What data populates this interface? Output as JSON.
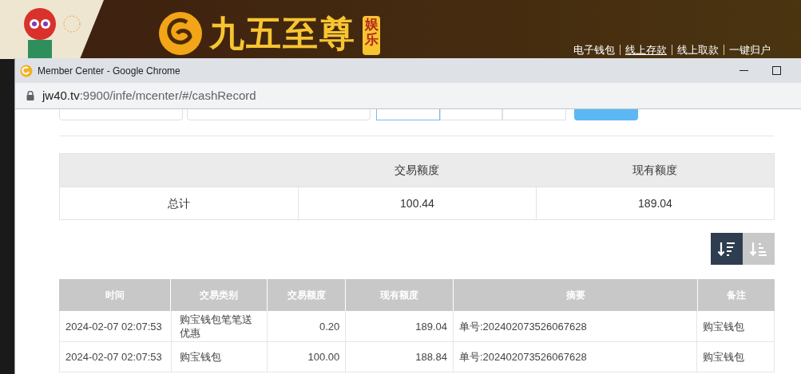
{
  "site": {
    "logo_text": "九五至尊",
    "logo_badge": "娱乐",
    "nav": [
      {
        "label": "电子钱包",
        "selected": false
      },
      {
        "label": "线上存款",
        "selected": true
      },
      {
        "label": "线上取款",
        "selected": false
      },
      {
        "label": "一键归户",
        "selected": false
      }
    ]
  },
  "window": {
    "title": "Member Center - Google Chrome",
    "url_host": "jw40.tv",
    "url_rest": ":9900/infe/mcenter/#/cashRecord"
  },
  "filters": [
    {
      "kind": "input"
    },
    {
      "kind": "input"
    },
    {
      "kind": "segment",
      "selected": true
    },
    {
      "kind": "segment",
      "selected": false
    },
    {
      "kind": "segment",
      "selected": false
    },
    {
      "kind": "button"
    }
  ],
  "summary": {
    "columns": [
      "",
      "交易额度",
      "现有额度"
    ],
    "row": [
      "总计",
      "100.44",
      "189.04"
    ]
  },
  "sort_buttons": [
    {
      "kind": "descending",
      "selected": true
    },
    {
      "kind": "ascending",
      "selected": false
    }
  ],
  "table": {
    "columns": [
      "时间",
      "交易类别",
      "交易额度",
      "现有额度",
      "摘要",
      "备注"
    ],
    "rows": [
      [
        "2024-02-07 02:07:53",
        "购宝钱包笔笔送优惠",
        "0.20",
        "189.04",
        "单号:202402073526067628",
        "购宝钱包"
      ],
      [
        "2024-02-07 02:07:53",
        "购宝钱包",
        "100.00",
        "188.84",
        "单号:202402073526067628",
        "购宝钱包"
      ]
    ]
  }
}
